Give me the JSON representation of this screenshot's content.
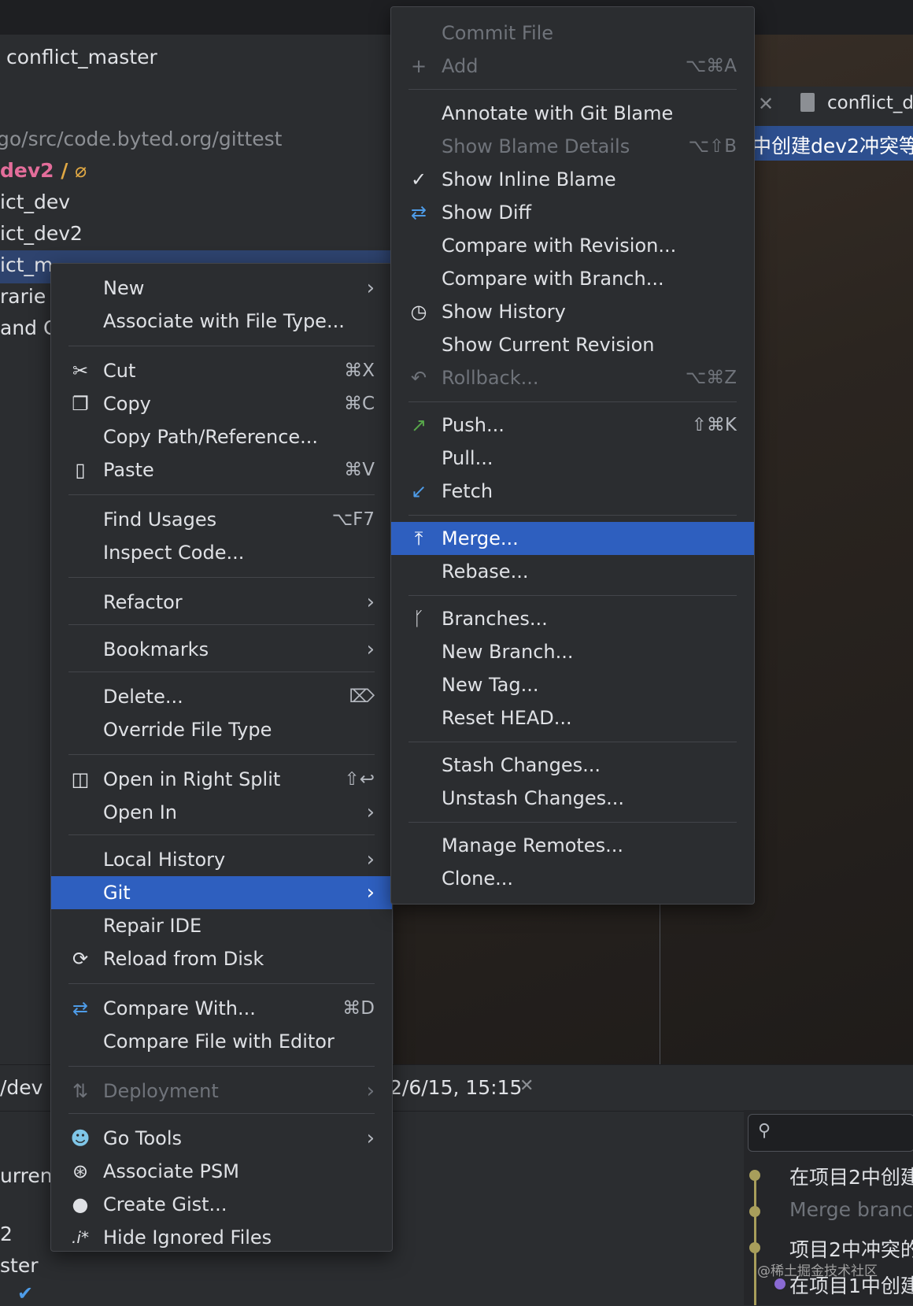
{
  "project": {
    "title": "conflict_master",
    "path": "go/src/code.byted.org/gittest",
    "branch": "dev2",
    "tree": [
      "ict_dev",
      "ict_dev2",
      "ict_m",
      "rarie",
      "and C"
    ]
  },
  "editor": {
    "tab_label": "conflict_de",
    "banner": "中创建dev2冲突等"
  },
  "bottom": {
    "tab_partial": "/dev",
    "timestamp_tab": "2/6/15, 15:15",
    "left_items": [
      "urrent",
      "2",
      "ster"
    ],
    "log_entries": [
      "在项目2中创建",
      "Merge branc",
      "项目2中冲突的",
      "在项目1中创建"
    ],
    "watermark": "@稀土掘金技术社区"
  },
  "context_menu": {
    "items": [
      {
        "label": "New",
        "submenu": true
      },
      {
        "label": "Associate with File Type..."
      },
      {
        "label": "Cut",
        "shortcut": "⌘X",
        "icon": "scissors-icon"
      },
      {
        "label": "Copy",
        "shortcut": "⌘C",
        "icon": "copy-icon"
      },
      {
        "label": "Copy Path/Reference..."
      },
      {
        "label": "Paste",
        "shortcut": "⌘V",
        "icon": "clipboard-icon"
      },
      {
        "label": "Find Usages",
        "shortcut": "⌥F7"
      },
      {
        "label": "Inspect Code..."
      },
      {
        "label": "Refactor",
        "submenu": true
      },
      {
        "label": "Bookmarks",
        "submenu": true
      },
      {
        "label": "Delete...",
        "icon": "delete-key-icon"
      },
      {
        "label": "Override File Type"
      },
      {
        "label": "Open in Right Split",
        "shortcut": "⇧↩",
        "icon": "split-icon"
      },
      {
        "label": "Open In",
        "submenu": true
      },
      {
        "label": "Local History",
        "submenu": true
      },
      {
        "label": "Git",
        "submenu": true,
        "selected": true
      },
      {
        "label": "Repair IDE"
      },
      {
        "label": "Reload from Disk",
        "icon": "reload-icon"
      },
      {
        "label": "Compare With...",
        "shortcut": "⌘D",
        "icon": "compare-icon"
      },
      {
        "label": "Compare File with Editor"
      },
      {
        "label": "Deployment",
        "submenu": true,
        "disabled": true,
        "icon": "deployment-icon"
      },
      {
        "label": "Go Tools",
        "submenu": true,
        "icon": "gopher-icon"
      },
      {
        "label": "Associate PSM",
        "icon": "psm-icon"
      },
      {
        "label": "Create Gist...",
        "icon": "github-icon"
      },
      {
        "label": "Hide Ignored Files",
        "icon": "ignore-icon"
      }
    ]
  },
  "git_menu": {
    "items": [
      {
        "label": "Commit File",
        "disabled": true
      },
      {
        "label": "Add",
        "shortcut": "⌥⌘A",
        "disabled": true,
        "icon": "plus-icon"
      },
      {
        "label": "Annotate with Git Blame"
      },
      {
        "label": "Show Blame Details",
        "shortcut": "⌥⇧B",
        "disabled": true
      },
      {
        "label": "Show Inline Blame",
        "icon": "check-icon"
      },
      {
        "label": "Show Diff",
        "icon": "diff-icon"
      },
      {
        "label": "Compare with Revision..."
      },
      {
        "label": "Compare with Branch..."
      },
      {
        "label": "Show History",
        "icon": "clock-icon"
      },
      {
        "label": "Show Current Revision"
      },
      {
        "label": "Rollback...",
        "shortcut": "⌥⌘Z",
        "disabled": true,
        "icon": "rollback-icon"
      },
      {
        "label": "Push...",
        "shortcut": "⇧⌘K",
        "icon": "push-icon"
      },
      {
        "label": "Pull..."
      },
      {
        "label": "Fetch",
        "icon": "fetch-icon"
      },
      {
        "label": "Merge...",
        "selected": true,
        "icon": "merge-icon"
      },
      {
        "label": "Rebase..."
      },
      {
        "label": "Branches...",
        "icon": "branch-icon"
      },
      {
        "label": "New Branch..."
      },
      {
        "label": "New Tag..."
      },
      {
        "label": "Reset HEAD..."
      },
      {
        "label": "Stash Changes..."
      },
      {
        "label": "Unstash Changes..."
      },
      {
        "label": "Manage Remotes..."
      },
      {
        "label": "Clone..."
      }
    ]
  }
}
